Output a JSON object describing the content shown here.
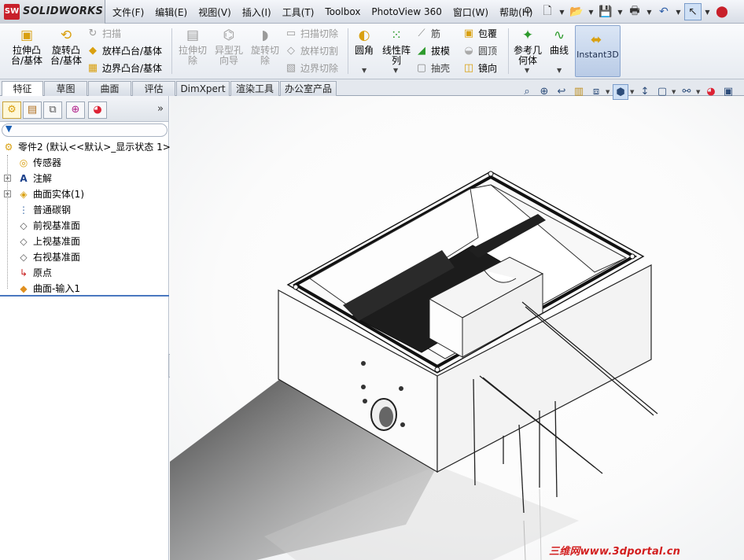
{
  "app": {
    "brand": "SOLIDWORKS",
    "brand_mark": "SW"
  },
  "menu": [
    "文件(F)",
    "编辑(E)",
    "视图(V)",
    "插入(I)",
    "工具(T)",
    "Toolbox",
    "PhotoView 360",
    "窗口(W)",
    "帮助(H)"
  ],
  "quick_icons": [
    "pin-icon",
    "new-document-icon",
    "open-folder-icon",
    "save-icon",
    "print-icon",
    "undo-icon",
    "select-arrow-icon",
    "traffic-light-icon"
  ],
  "ribbon": {
    "extrude_boss": "拉伸凸\n台/基体",
    "revolve_boss": "旋转凸\n台/基体",
    "sweep": "扫描",
    "loft_boss": "放样凸台/基体",
    "boundary_boss": "边界凸台/基体",
    "extrude_cut": "拉伸切\n除",
    "hole_wizard": "异型孔\n向导",
    "revolve_cut": "旋转切\n除",
    "swept_cut": "扫描切除",
    "lofted_cut": "放样切割",
    "boundary_cut": "边界切除",
    "fillet": "圆角",
    "linear_pattern": "线性阵\n列",
    "rib": "筋",
    "draft": "拔模",
    "shell": "抽壳",
    "wrap": "包覆",
    "dome": "圆顶",
    "mirror": "镜向",
    "ref_geometry": "参考几\n何体",
    "curves": "曲线",
    "instant3d": "Instant3D"
  },
  "tabs": [
    "特征",
    "草图",
    "曲面",
    "评估",
    "DimXpert",
    "渲染工具",
    "办公室产品"
  ],
  "active_tab": 0,
  "panel_tabs": [
    "feature-manager-icon",
    "property-manager-icon",
    "configuration-manager-icon",
    "dimxpert-manager-icon",
    "display-manager-icon"
  ],
  "panel_more": "»",
  "tree": {
    "root": "零件2 (默认<<默认>_显示状态 1>",
    "items": [
      {
        "label": "传感器",
        "icon": "sensor-icon",
        "expandable": false
      },
      {
        "label": "注解",
        "icon": "annotations-icon",
        "expandable": true
      },
      {
        "label": "曲面实体(1)",
        "icon": "surface-bodies-icon",
        "expandable": true
      },
      {
        "label": "普通碳钢",
        "icon": "material-icon",
        "expandable": false
      },
      {
        "label": "前视基准面",
        "icon": "plane-icon",
        "expandable": false
      },
      {
        "label": "上视基准面",
        "icon": "plane-icon",
        "expandable": false
      },
      {
        "label": "右视基准面",
        "icon": "plane-icon",
        "expandable": false
      },
      {
        "label": "原点",
        "icon": "origin-icon",
        "expandable": false
      },
      {
        "label": "曲面-输入1",
        "icon": "imported-surface-icon",
        "expandable": false
      }
    ]
  },
  "view_toolbar": [
    "zoom-to-fit-icon",
    "zoom-area-icon",
    "previous-view-icon",
    "section-view-icon",
    "view-orientation-icon",
    "display-style-icon",
    "hide-show-icon",
    "edit-appearance-icon",
    "apply-scene-icon",
    "view-settings-icon"
  ],
  "watermark": "三维网www.3dportal.cn"
}
